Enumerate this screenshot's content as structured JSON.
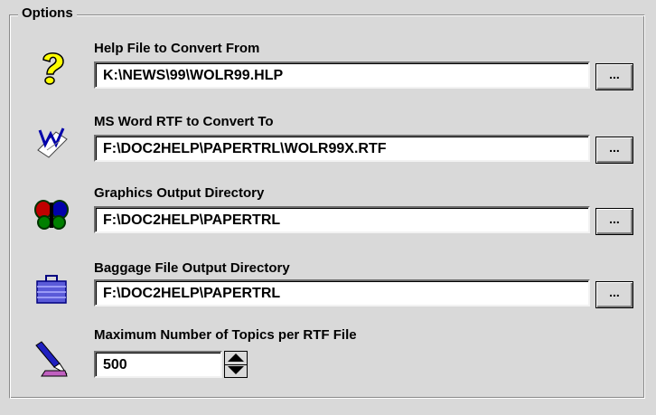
{
  "group": {
    "title": "Options"
  },
  "help_file": {
    "label": "Help File to Convert From",
    "value": "K:\\NEWS\\99\\WOLR99.HLP",
    "icon": "question-icon"
  },
  "rtf_file": {
    "label": "MS Word RTF to Convert To",
    "value": "F:\\DOC2HELP\\PAPERTRL\\WOLR99X.RTF",
    "icon": "word-document-icon"
  },
  "graphics_dir": {
    "label": "Graphics Output Directory",
    "value": "F:\\DOC2HELP\\PAPERTRL",
    "icon": "butterfly-icon"
  },
  "baggage_dir": {
    "label": "Baggage File Output Directory",
    "value": "F:\\DOC2HELP\\PAPERTRL",
    "icon": "briefcase-icon"
  },
  "max_topics": {
    "label": "Maximum Number of Topics per RTF File",
    "value": "500",
    "icon": "pencil-icon"
  },
  "browse_label": "..."
}
